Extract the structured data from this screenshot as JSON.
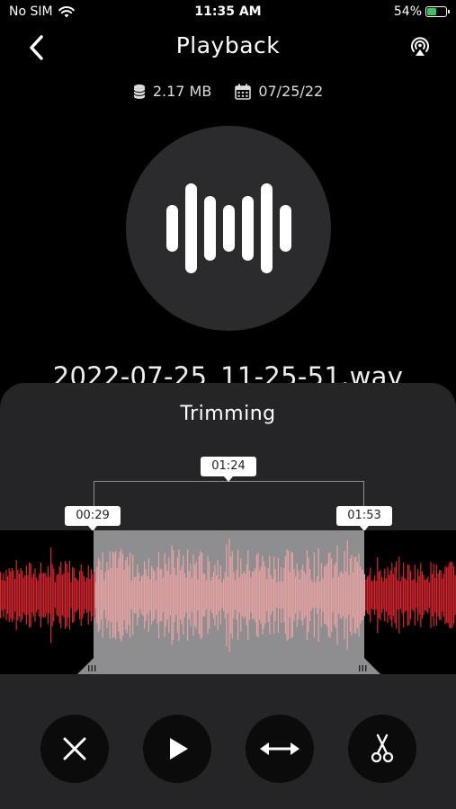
{
  "status_bar": {
    "carrier": "No SIM",
    "time": "11:35 AM",
    "battery_percent": "54%",
    "battery_level": 0.54
  },
  "nav": {
    "title": "Playback",
    "back_icon": "chevron-left-icon",
    "airplay_icon": "airplay-icon"
  },
  "meta": {
    "size": "2.17 MB",
    "date": "07/25/22"
  },
  "file_name": "2022-07-25_11-25-51.wav",
  "trimming": {
    "title": "Trimming",
    "duration_label": "01:24",
    "start_label": "00:29",
    "end_label": "01:53"
  },
  "controls": {
    "cancel_icon": "close-icon",
    "play_icon": "play-icon",
    "fit_icon": "arrows-horizontal-icon",
    "cut_icon": "scissors-icon"
  },
  "colors": {
    "accent_wave": "#d9262f",
    "selected_wave": "#e8a2a3",
    "selection_bg": "#8e8e90",
    "sheet_bg": "#252527"
  }
}
